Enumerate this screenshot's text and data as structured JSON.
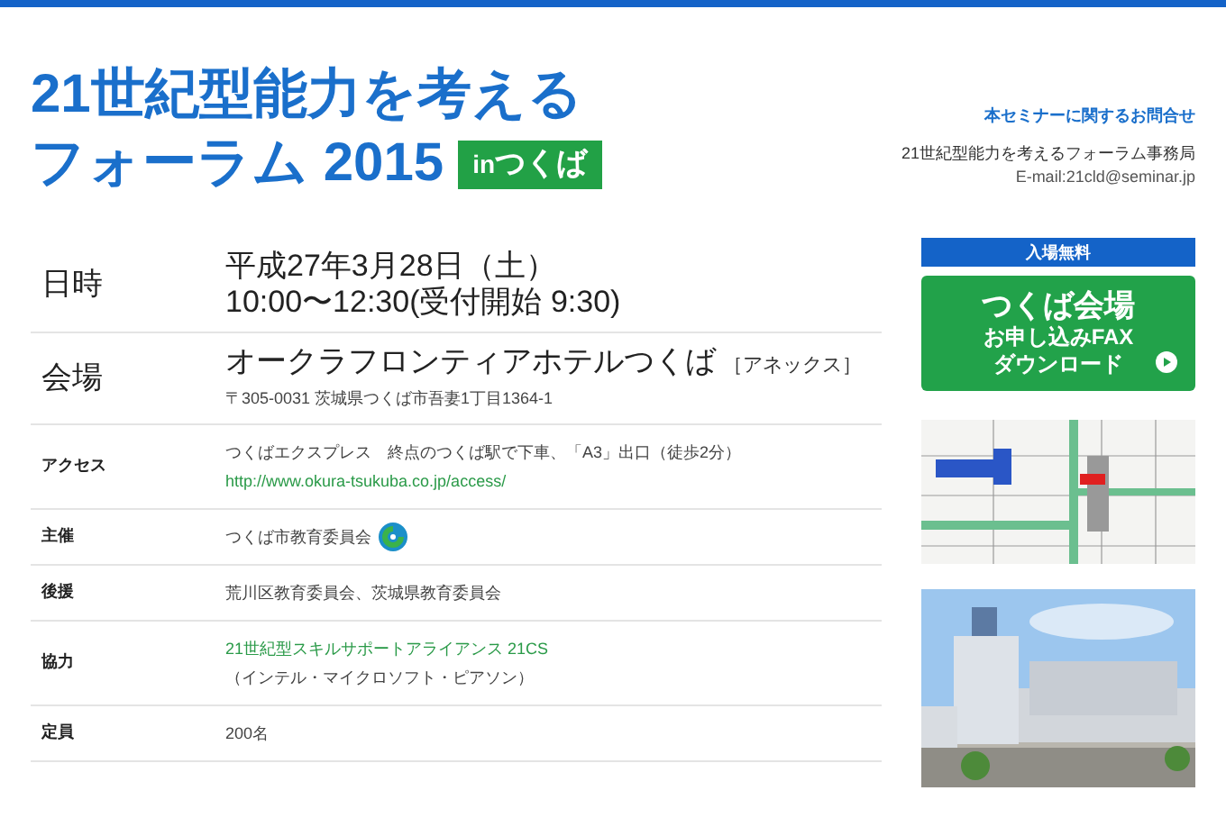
{
  "header": {
    "title_lines": [
      "21世紀型能力を考える",
      "フォーラム 2015"
    ],
    "badge": {
      "prefix": "in",
      "place": "つくば"
    }
  },
  "contact": {
    "heading": "本セミナーに関するお問合せ",
    "office": "21世紀型能力を考えるフォーラム事務局",
    "email": "E-mail:21cld@seminar.jp"
  },
  "details": [
    {
      "kind": "large",
      "label": "日時",
      "lines": [
        {
          "text": "平成27年3月28日（土）",
          "kind": "main"
        },
        {
          "text": "10:00〜12:30(受付開始 9:30)",
          "kind": "main"
        }
      ]
    },
    {
      "kind": "large",
      "label": "会場",
      "lines": [
        {
          "text": "オークラフロンティアホテルつくば",
          "suffix": "［アネックス］",
          "kind": "main"
        },
        {
          "text": "〒305-0031 茨城県つくば市吾妻1丁目1364-1",
          "kind": "plain"
        }
      ]
    },
    {
      "kind": "small",
      "label": "アクセス",
      "lines": [
        {
          "text": "つくばエクスプレス　終点のつくば駅で下車、「A3」出口（徒歩2分）",
          "kind": "plain"
        },
        {
          "text": "http://www.okura-tsukuba.co.jp/access/",
          "kind": "link"
        }
      ]
    },
    {
      "kind": "small",
      "label": "主催",
      "lines": [
        {
          "text": "つくば市教育委員会",
          "kind": "plain",
          "logo": true
        }
      ]
    },
    {
      "kind": "small",
      "label": "後援",
      "lines": [
        {
          "text": "荒川区教育委員会、茨城県教育委員会",
          "kind": "plain"
        }
      ]
    },
    {
      "kind": "small",
      "label": "協力",
      "lines": [
        {
          "text": "21世紀型スキルサポートアライアンス 21CS",
          "kind": "link"
        },
        {
          "text": "（インテル・マイクロソフト・ピアソン）",
          "kind": "plain"
        }
      ]
    },
    {
      "kind": "small",
      "label": "定員",
      "lines": [
        {
          "text": "200名",
          "kind": "plain"
        }
      ]
    }
  ],
  "sidebar": {
    "banner": "入場無料",
    "button_lines": [
      "つくば会場",
      "お申し込みFAX",
      "ダウンロード"
    ]
  }
}
